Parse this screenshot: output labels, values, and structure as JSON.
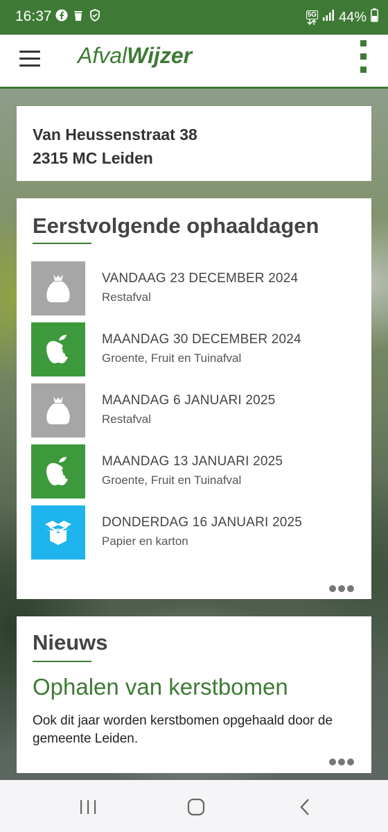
{
  "status_bar": {
    "time": "16:37",
    "network": "5G",
    "battery": "44%"
  },
  "app_bar": {
    "logo_part1": "Afval",
    "logo_part2": "Wijzer"
  },
  "address": {
    "street": "Van Heussenstraat 38",
    "postcode_city": "2315 MC Leiden"
  },
  "collections": {
    "title": "Eerstvolgende ophaaldagen",
    "items": [
      {
        "date": "VANDAAG 23 DECEMBER 2024",
        "type": "Restafval",
        "icon": "trash-bag-icon",
        "color": "#a6a6a6"
      },
      {
        "date": "MAANDAG 30 DECEMBER 2024",
        "type": "Groente, Fruit en Tuinafval",
        "icon": "apple-icon",
        "color": "#3d9a3c"
      },
      {
        "date": "MAANDAG 6 JANUARI 2025",
        "type": "Restafval",
        "icon": "trash-bag-icon",
        "color": "#a6a6a6"
      },
      {
        "date": "MAANDAG 13 JANUARI 2025",
        "type": "Groente, Fruit en Tuinafval",
        "icon": "apple-icon",
        "color": "#3d9a3c"
      },
      {
        "date": "DONDERDAG 16 JANUARI 2025",
        "type": "Papier en karton",
        "icon": "box-icon",
        "color": "#1eb4ee"
      }
    ]
  },
  "news": {
    "title": "Nieuws",
    "headline": "Ophalen van kerstbomen",
    "body": "Ook dit jaar worden kerstbomen opgehaald door de gemeente Leiden."
  },
  "colors": {
    "brand_green": "#3e7a35",
    "restafval_gray": "#a6a6a6",
    "gft_green": "#3d9a3c",
    "papier_blue": "#1eb4ee"
  }
}
